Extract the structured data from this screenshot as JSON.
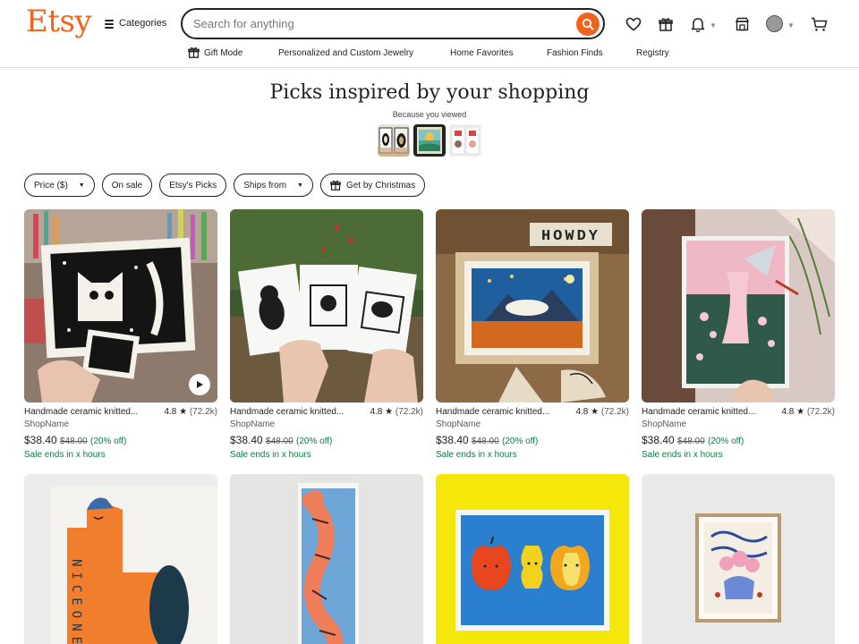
{
  "header": {
    "logo": "Etsy",
    "categories_label": "Categories",
    "search_placeholder": "Search for anything",
    "accent_color": "#f1641e"
  },
  "subnav": {
    "items": [
      "Gift Mode",
      "Personalized and Custom Jewelry",
      "Home Favorites",
      "Fashion Finds",
      "Registry"
    ]
  },
  "main": {
    "title": "Picks inspired by your shopping",
    "because_label": "Because you viewed"
  },
  "filters": [
    {
      "label": "Price ($)",
      "dropdown": true
    },
    {
      "label": "On sale",
      "dropdown": false
    },
    {
      "label": "Etsy's Picks",
      "dropdown": false
    },
    {
      "label": "Ships from",
      "dropdown": true
    },
    {
      "label": "Get by Christmas",
      "dropdown": false,
      "icon": "gift-icon"
    }
  ],
  "products": [
    {
      "title": "Handmade ceramic knitted...",
      "rating": "4.8",
      "reviews": "(72.2k)",
      "shop": "ShopName",
      "price": "$38.40",
      "original": "$48.00",
      "discount": "(20% off)",
      "sale": "Sale ends in x hours",
      "has_video": true
    },
    {
      "title": "Handmade ceramic knitted...",
      "rating": "4.8",
      "reviews": "(72.2k)",
      "shop": "ShopName",
      "price": "$38.40",
      "original": "$48.00",
      "discount": "(20% off)",
      "sale": "Sale ends in x hours",
      "has_video": false
    },
    {
      "title": "Handmade ceramic knitted...",
      "rating": "4.8",
      "reviews": "(72.2k)",
      "shop": "ShopName",
      "price": "$38.40",
      "original": "$48.00",
      "discount": "(20% off)",
      "sale": "Sale ends in x hours",
      "has_video": false
    },
    {
      "title": "Handmade ceramic knitted...",
      "rating": "4.8",
      "reviews": "(72.2k)",
      "shop": "ShopName",
      "price": "$38.40",
      "original": "$48.00",
      "discount": "(20% off)",
      "sale": "Sale ends in x hours",
      "has_video": false
    }
  ],
  "images": {
    "howdy_text": "HOWDY",
    "nice_one_text": "NICEONE"
  }
}
